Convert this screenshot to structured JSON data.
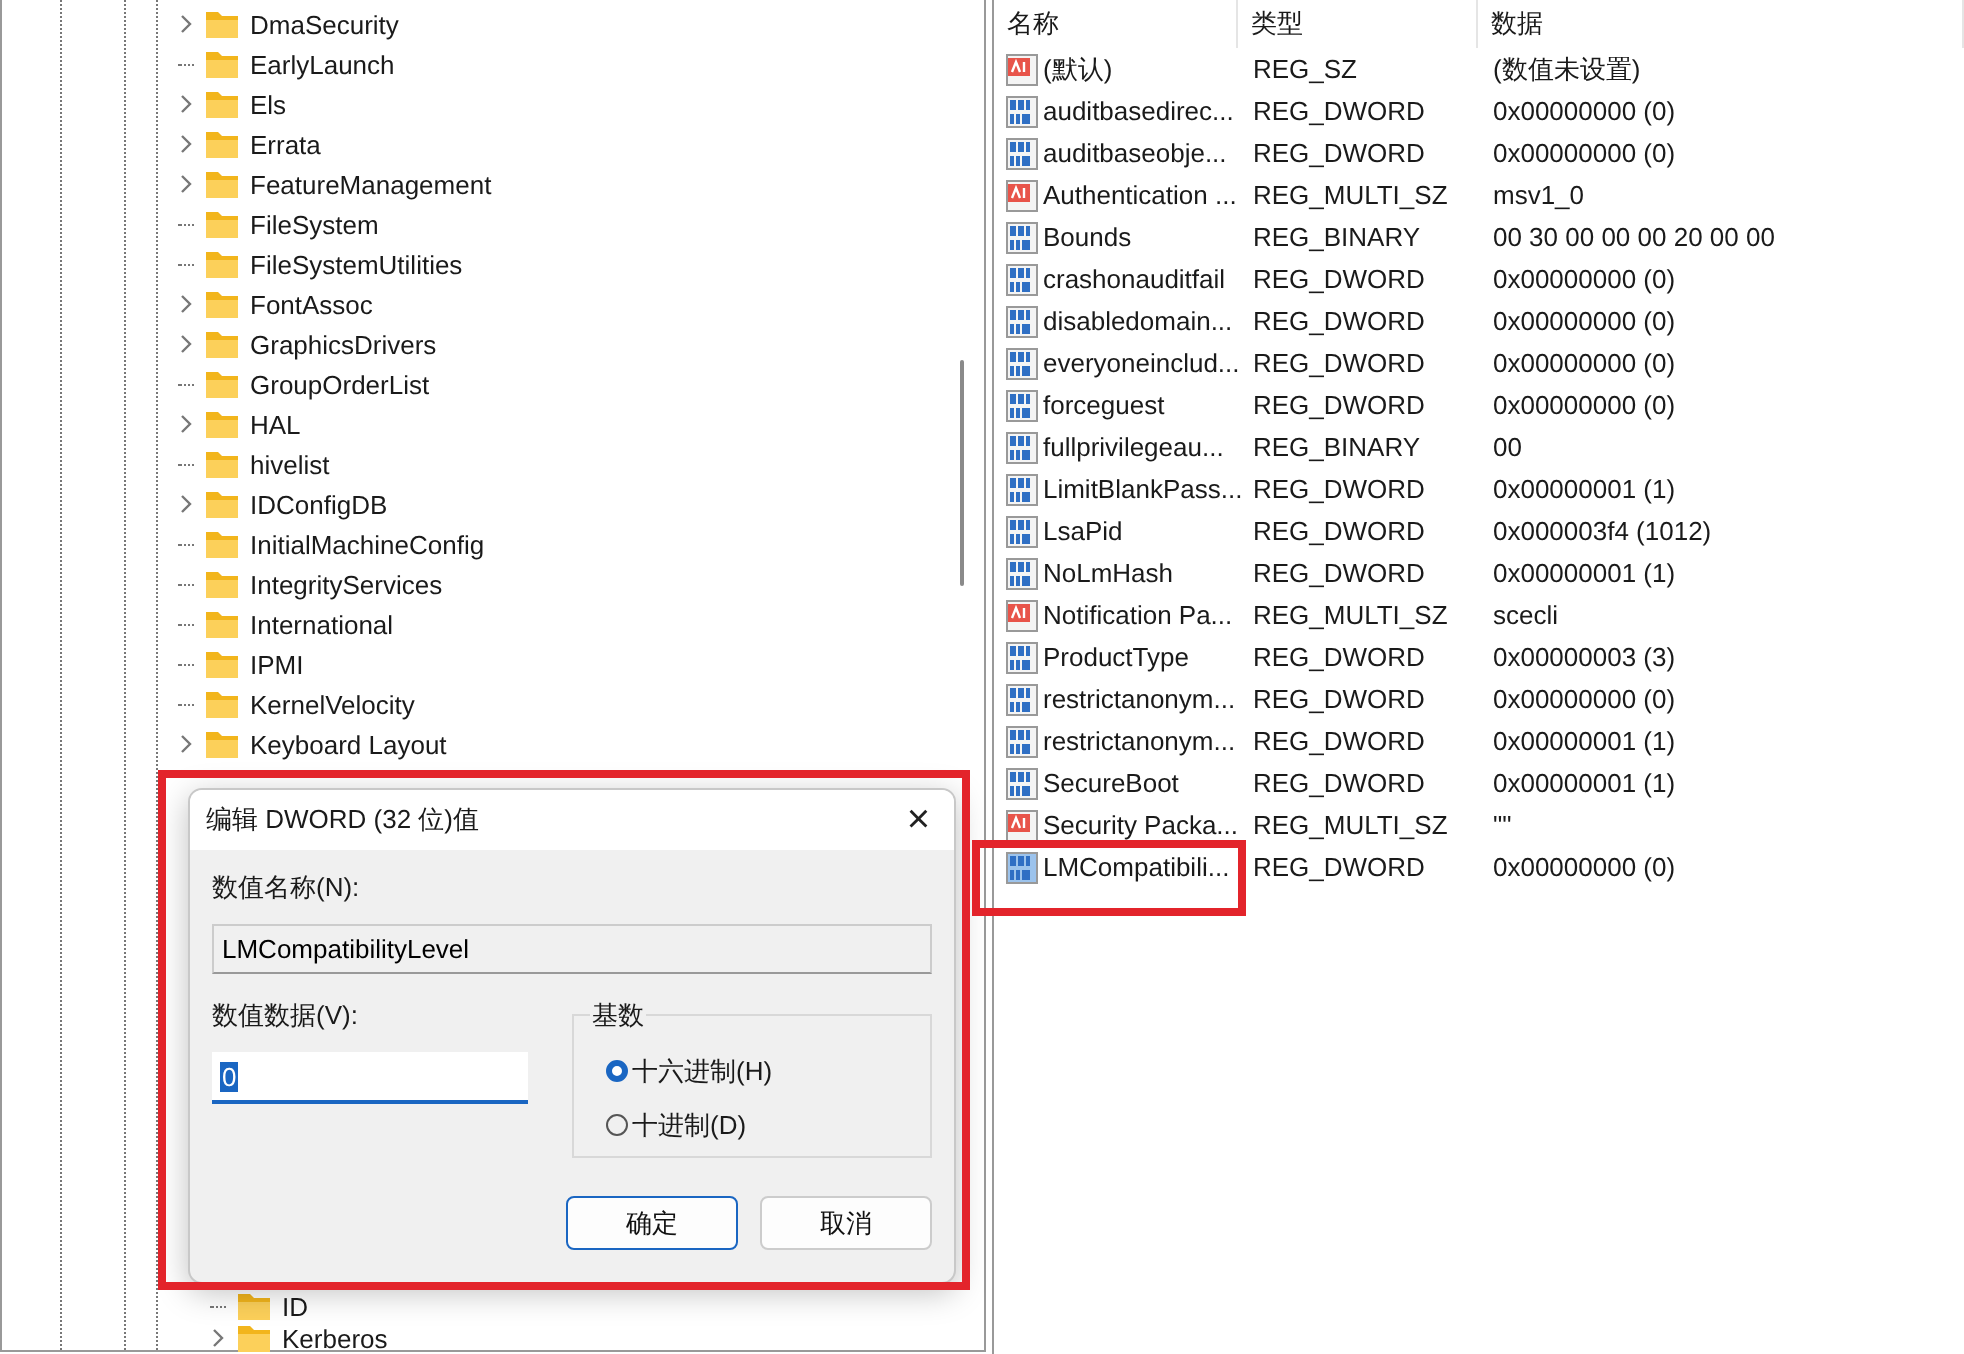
{
  "tree": {
    "items": [
      {
        "label": "DmaSecurity",
        "expandable": true
      },
      {
        "label": "EarlyLaunch",
        "expandable": false
      },
      {
        "label": "Els",
        "expandable": true
      },
      {
        "label": "Errata",
        "expandable": true
      },
      {
        "label": "FeatureManagement",
        "expandable": true
      },
      {
        "label": "FileSystem",
        "expandable": false
      },
      {
        "label": "FileSystemUtilities",
        "expandable": false
      },
      {
        "label": "FontAssoc",
        "expandable": true
      },
      {
        "label": "GraphicsDrivers",
        "expandable": true
      },
      {
        "label": "GroupOrderList",
        "expandable": false
      },
      {
        "label": "HAL",
        "expandable": true
      },
      {
        "label": "hivelist",
        "expandable": false
      },
      {
        "label": "IDConfigDB",
        "expandable": true
      },
      {
        "label": "InitialMachineConfig",
        "expandable": false
      },
      {
        "label": "IntegrityServices",
        "expandable": false
      },
      {
        "label": "International",
        "expandable": false
      },
      {
        "label": "IPMI",
        "expandable": false
      },
      {
        "label": "KernelVelocity",
        "expandable": false
      },
      {
        "label": "Keyboard Layout",
        "expandable": true
      }
    ],
    "children": [
      {
        "label": "ID",
        "expandable": false
      },
      {
        "label": "Kerberos",
        "expandable": true
      }
    ]
  },
  "values": {
    "columns": [
      "名称",
      "类型",
      "数据"
    ],
    "rows": [
      {
        "name": "(默认)",
        "kind": "string",
        "type": "REG_SZ",
        "data": "(数值未设置)",
        "selected": false
      },
      {
        "name": "auditbasedirec...",
        "kind": "binary",
        "type": "REG_DWORD",
        "data": "0x00000000 (0)",
        "selected": false
      },
      {
        "name": "auditbaseobje...",
        "kind": "binary",
        "type": "REG_DWORD",
        "data": "0x00000000 (0)",
        "selected": false
      },
      {
        "name": "Authentication ...",
        "kind": "string",
        "type": "REG_MULTI_SZ",
        "data": "msv1_0",
        "selected": false
      },
      {
        "name": "Bounds",
        "kind": "binary",
        "type": "REG_BINARY",
        "data": "00 30 00 00 00 20 00 00",
        "selected": false
      },
      {
        "name": "crashonauditfail",
        "kind": "binary",
        "type": "REG_DWORD",
        "data": "0x00000000 (0)",
        "selected": false
      },
      {
        "name": "disabledomain...",
        "kind": "binary",
        "type": "REG_DWORD",
        "data": "0x00000000 (0)",
        "selected": false
      },
      {
        "name": "everyoneinclud...",
        "kind": "binary",
        "type": "REG_DWORD",
        "data": "0x00000000 (0)",
        "selected": false
      },
      {
        "name": "forceguest",
        "kind": "binary",
        "type": "REG_DWORD",
        "data": "0x00000000 (0)",
        "selected": false
      },
      {
        "name": "fullprivilegeau...",
        "kind": "binary",
        "type": "REG_BINARY",
        "data": "00",
        "selected": false
      },
      {
        "name": "LimitBlankPass...",
        "kind": "binary",
        "type": "REG_DWORD",
        "data": "0x00000001 (1)",
        "selected": false
      },
      {
        "name": "LsaPid",
        "kind": "binary",
        "type": "REG_DWORD",
        "data": "0x000003f4 (1012)",
        "selected": false
      },
      {
        "name": "NoLmHash",
        "kind": "binary",
        "type": "REG_DWORD",
        "data": "0x00000001 (1)",
        "selected": false
      },
      {
        "name": "Notification Pa...",
        "kind": "string",
        "type": "REG_MULTI_SZ",
        "data": "scecli",
        "selected": false
      },
      {
        "name": "ProductType",
        "kind": "binary",
        "type": "REG_DWORD",
        "data": "0x00000003 (3)",
        "selected": false
      },
      {
        "name": "restrictanonym...",
        "kind": "binary",
        "type": "REG_DWORD",
        "data": "0x00000000 (0)",
        "selected": false
      },
      {
        "name": "restrictanonym...",
        "kind": "binary",
        "type": "REG_DWORD",
        "data": "0x00000001 (1)",
        "selected": false
      },
      {
        "name": "SecureBoot",
        "kind": "binary",
        "type": "REG_DWORD",
        "data": "0x00000001 (1)",
        "selected": false
      },
      {
        "name": "Security Packa...",
        "kind": "string",
        "type": "REG_MULTI_SZ",
        "data": "\"\"",
        "selected": false
      },
      {
        "name": "LMCompatibili...",
        "kind": "binary",
        "type": "REG_DWORD",
        "data": "0x00000000 (0)",
        "selected": true
      }
    ]
  },
  "dialog": {
    "title": "编辑 DWORD (32 位)值",
    "close": "×",
    "name_label": "数值名称(N):",
    "name_value": "LMCompatibilityLevel",
    "data_label": "数值数据(V):",
    "data_value": "0",
    "base_label": "基数",
    "radios": [
      {
        "label": "十六进制(H)",
        "selected": true
      },
      {
        "label": "十进制(D)",
        "selected": false
      }
    ],
    "buttons": [
      {
        "label": "确定",
        "kind": "default"
      },
      {
        "label": "取消",
        "kind": "normal"
      }
    ]
  }
}
